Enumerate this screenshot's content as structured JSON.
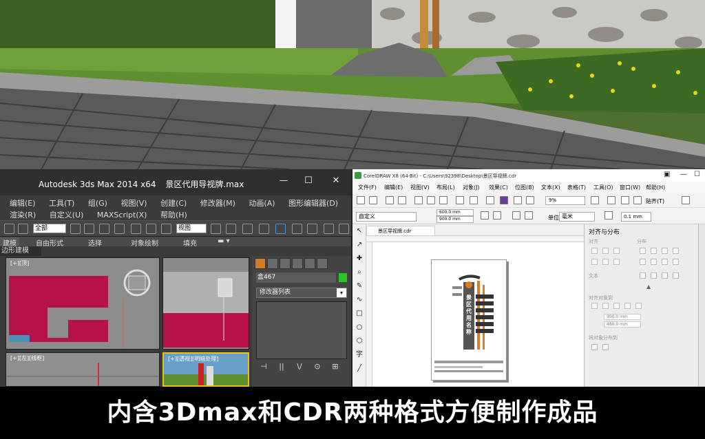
{
  "max_window": {
    "app_title": "Autodesk 3ds Max  2014 x64",
    "file_name": "景区代用导视牌.max",
    "window_controls": [
      "—",
      "☐",
      "✕"
    ],
    "menu_row1": [
      "编辑(E)",
      "工具(T)",
      "组(G)",
      "视图(V)",
      "创建(C)",
      "修改器(M)",
      "动画(A)",
      "图形编辑器(D)"
    ],
    "menu_row2": [
      "渲染(R)",
      "自定义(U)",
      "MAXScript(X)",
      "帮助(H)"
    ],
    "selection_filter": "全部",
    "ref_coord": "视图",
    "ribbon_tabs": [
      "建模",
      "自由形式",
      "选择",
      "对象绘制",
      "填充"
    ],
    "subtab": "边形建模",
    "viewport_labels": [
      "[+][顶]",
      "[+][前]",
      "[+][左][线框]",
      "[+][透视][明暗处理]"
    ],
    "object_name": "盒467",
    "object_color": "#29c429",
    "modifier_list": "修改器列表",
    "stack_buttons": [
      "⊣",
      "||",
      "\\/",
      "⊙",
      "⊞"
    ]
  },
  "corel_window": {
    "title": "CorelDRAW X8 (64-Bit) - C:\\Users\\92398\\Desktop\\景区导视牌.cdr",
    "menu": [
      "文件(F)",
      "编辑(E)",
      "视图(V)",
      "布局(L)",
      "对象(J)",
      "效果(C)",
      "位图(B)",
      "文本(X)",
      "表格(T)",
      "工具(O)",
      "窗口(W)",
      "帮助(H)"
    ],
    "zoom": "9%",
    "snap_label": "贴齐(T)",
    "page_preset": "自定义",
    "page_width": "600.0 mm",
    "page_height": "900.0 mm",
    "unit_label": "单位:",
    "unit": "毫米",
    "nudge": "0.1 mm",
    "doc_tab": "景区导视牌.cdr",
    "docker_title": "对齐与分布",
    "docker_sections": [
      "对齐",
      "分布",
      "文本",
      "对齐对象到",
      "将对象分布到"
    ],
    "docker_width": "300.0 mm",
    "docker_height": "480.0 mm",
    "sign_text": "景区代用名称"
  },
  "caption": "内含3Dmax和CDR两种格式方便制作成品"
}
